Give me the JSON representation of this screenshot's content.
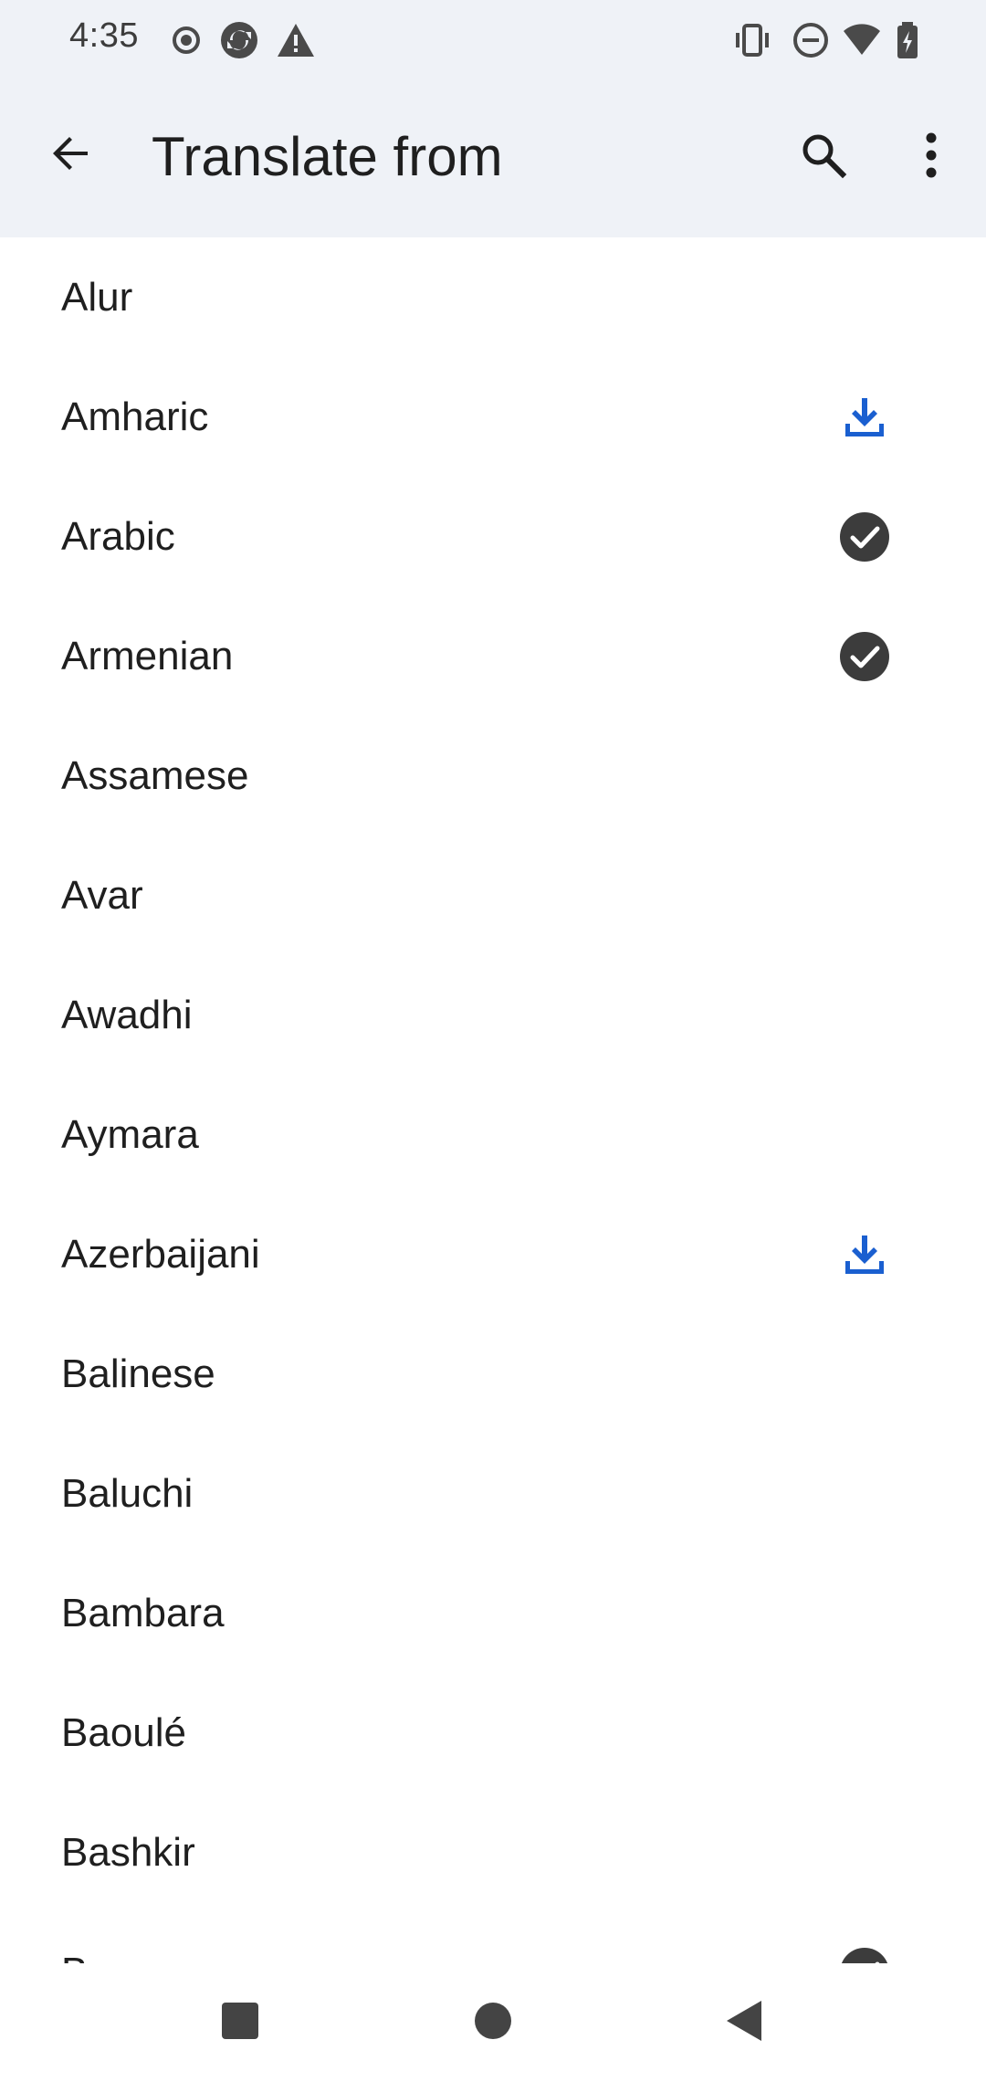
{
  "status_bar": {
    "time": "4:35",
    "icons": [
      "record-icon",
      "sync-icon",
      "warning-icon",
      "vibrate-icon",
      "dnd-icon",
      "wifi-icon",
      "battery-icon"
    ]
  },
  "app_bar": {
    "title": "Translate from",
    "back_icon": "arrow-left-icon",
    "search_icon": "search-icon",
    "more_icon": "more-vertical-icon"
  },
  "languages": [
    {
      "label": "Alur",
      "status": "none"
    },
    {
      "label": "Amharic",
      "status": "download"
    },
    {
      "label": "Arabic",
      "status": "downloaded"
    },
    {
      "label": "Armenian",
      "status": "downloaded"
    },
    {
      "label": "Assamese",
      "status": "none"
    },
    {
      "label": "Avar",
      "status": "none"
    },
    {
      "label": "Awadhi",
      "status": "none"
    },
    {
      "label": "Aymara",
      "status": "none"
    },
    {
      "label": "Azerbaijani",
      "status": "download"
    },
    {
      "label": "Balinese",
      "status": "none"
    },
    {
      "label": "Baluchi",
      "status": "none"
    },
    {
      "label": "Bambara",
      "status": "none"
    },
    {
      "label": "Baoulé",
      "status": "none"
    },
    {
      "label": "Bashkir",
      "status": "none"
    },
    {
      "label": "Basque",
      "status": "downloaded"
    }
  ],
  "colors": {
    "app_bar_bg": "#eff2f7",
    "download_blue": "#1a5fd0",
    "check_circle": "#3c3c3c"
  },
  "nav_bar": {
    "icons": [
      "recents-icon",
      "home-icon",
      "back-icon"
    ]
  }
}
